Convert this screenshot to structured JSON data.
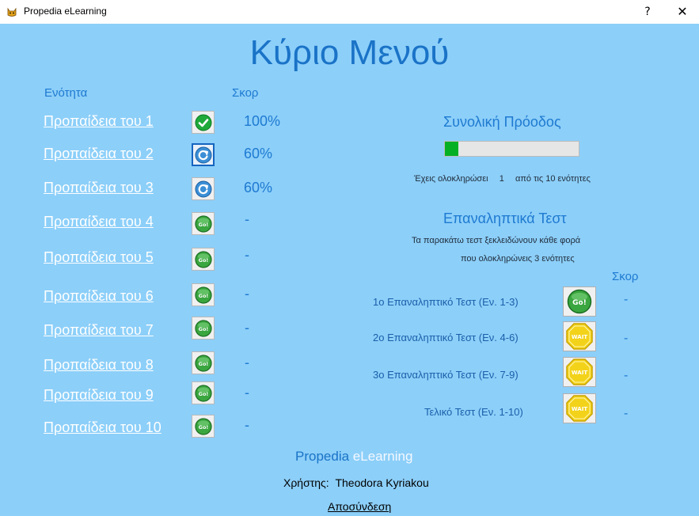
{
  "window": {
    "title": "Propedia eLearning",
    "help_glyph": "?",
    "close_glyph": "✕",
    "app_icon": "cat-icon"
  },
  "main_title": "Κύριο Μενού",
  "columns": {
    "unit_header": "Ενότητα",
    "score_header": "Σκορ"
  },
  "lessons": [
    {
      "label": "Προπαίδεια του 1",
      "score": "100%",
      "status": "completed"
    },
    {
      "label": "Προπαίδεια του 2",
      "score": "60%",
      "status": "retry"
    },
    {
      "label": "Προπαίδεια του 3",
      "score": "60%",
      "status": "retry"
    },
    {
      "label": "Προπαίδεια του 4",
      "score": "-",
      "status": "go"
    },
    {
      "label": "Προπαίδεια του 5",
      "score": "-",
      "status": "go"
    },
    {
      "label": "Προπαίδεια του 6",
      "score": "-",
      "status": "go"
    },
    {
      "label": "Προπαίδεια του 7",
      "score": "-",
      "status": "go"
    },
    {
      "label": "Προπαίδεια του 8",
      "score": "-",
      "status": "go"
    },
    {
      "label": "Προπαίδεια του 9",
      "score": "-",
      "status": "go"
    },
    {
      "label": "Προπαίδεια του 10",
      "score": "-",
      "status": "go"
    }
  ],
  "progress": {
    "title": "Συνολική Πρόοδος",
    "fraction": 0.1,
    "text_before": "Έχεις ολοκληρώσει",
    "completed": "1",
    "text_after": "από τις 10 ενότητες",
    "fill_color": "#06b025"
  },
  "review": {
    "title": "Επαναληπτικά Τεστ",
    "note_line1": "Τα παρακάτω τεστ ξεκλειδώνουν κάθε φορά",
    "note_line2": "που ολοκληρώνεις 3 ενότητες",
    "score_header": "Σκορ",
    "tests": [
      {
        "label": "1ο Επαναληπτικό Τεστ (Εν. 1-3)",
        "button": "Go!",
        "state": "go",
        "score": "-"
      },
      {
        "label": "2ο Επαναληπτικό Τεστ (Εν. 4-6)",
        "button": "WAIT",
        "state": "wait",
        "score": "-"
      },
      {
        "label": "3ο Επαναληπτικό Τεστ (Εν. 7-9)",
        "button": "WAIT",
        "state": "wait",
        "score": "-"
      },
      {
        "label": "Τελικό Τεστ (Εν. 1-10)",
        "button": "WAIT",
        "state": "wait",
        "score": "-"
      }
    ]
  },
  "icons": {
    "completed": "check-icon",
    "retry": "retry-icon",
    "go": "go-icon",
    "wait": "wait-sign-icon"
  },
  "go_label": "Go!",
  "footer": {
    "brand_part1": "Propedia",
    "brand_part2": " eLearning",
    "user_label": "Χρήστης:",
    "user_name": "Theodora Kyriakou",
    "logout": "Αποσύνδεση"
  }
}
